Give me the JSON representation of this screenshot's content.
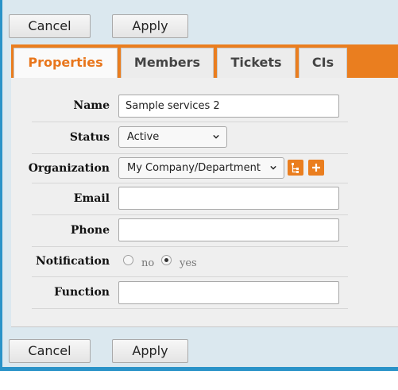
{
  "actions_top": {
    "cancel": "Cancel",
    "apply": "Apply"
  },
  "actions_bottom": {
    "cancel": "Cancel",
    "apply": "Apply"
  },
  "tabs": [
    {
      "label": "Properties",
      "active": true
    },
    {
      "label": "Members",
      "active": false
    },
    {
      "label": "Tickets",
      "active": false
    },
    {
      "label": "CIs",
      "active": false
    }
  ],
  "form": {
    "name": {
      "label": "Name",
      "value": "Sample services 2"
    },
    "status": {
      "label": "Status",
      "value": "Active"
    },
    "organization": {
      "label": "Organization",
      "value": "My Company/Department",
      "hierarchy_icon": "hierarchy-icon",
      "add_icon": "plus-icon"
    },
    "email": {
      "label": "Email",
      "value": ""
    },
    "phone": {
      "label": "Phone",
      "value": ""
    },
    "notification": {
      "label": "Notification",
      "options": [
        "no",
        "yes"
      ],
      "selected": "yes"
    },
    "function": {
      "label": "Function",
      "value": ""
    }
  },
  "colors": {
    "accent": "#ea7e1f",
    "frame": "#2a93c8",
    "background": "#dbe8ef"
  }
}
